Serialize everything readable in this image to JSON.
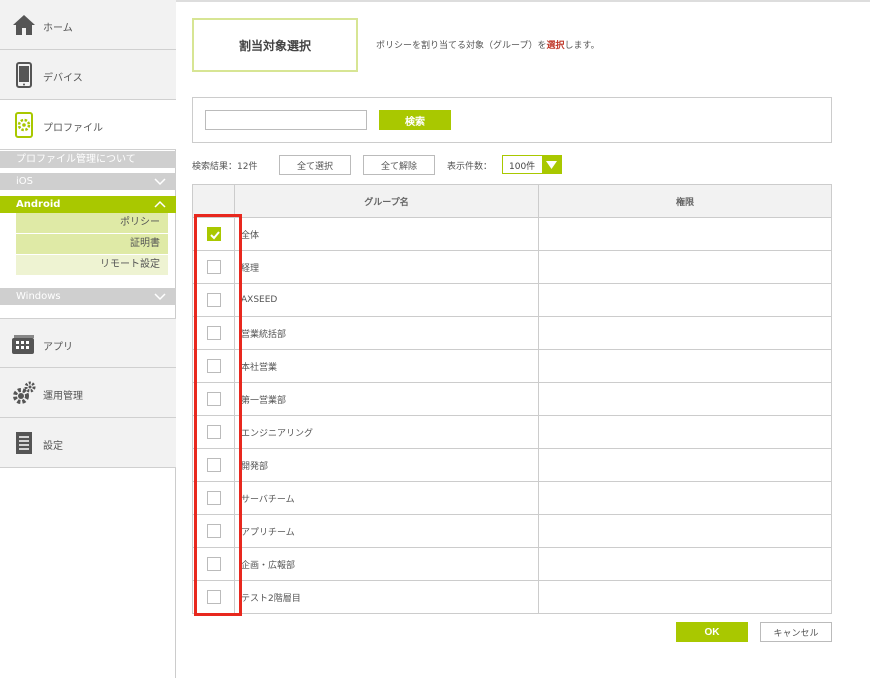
{
  "sidebar": {
    "nav": [
      {
        "label": "ホーム",
        "icon": "home-icon"
      },
      {
        "label": "デバイス",
        "icon": "device-icon"
      },
      {
        "label": "プロファイル",
        "icon": "profile-icon"
      },
      {
        "label": "アプリ",
        "icon": "app-icon"
      },
      {
        "label": "運用管理",
        "icon": "gear-icon"
      },
      {
        "label": "設定",
        "icon": "document-icon"
      }
    ],
    "profile_about": "プロファイル管理について",
    "ios": "iOS",
    "android": "Android",
    "android_items": [
      "ポリシー",
      "証明書",
      "リモート設定"
    ],
    "windows": "Windows"
  },
  "main": {
    "title": "割当対象選択",
    "desc_before": "ポリシーを割り当てる対象（グループ）を",
    "desc_em": "選択",
    "desc_after": "します。",
    "search_button": "検索",
    "search_value": "",
    "result_text": "検索結果：12件",
    "select_all": "全て選択",
    "unselect_all": "全て解除",
    "count_label": "表示件数：",
    "count_value": "100件",
    "col_group": "グループ名",
    "col_permission": "権限",
    "ok": "OK",
    "cancel": "キャンセル"
  },
  "rows": [
    {
      "name": "全体",
      "checked": true,
      "permission": ""
    },
    {
      "name": "経理",
      "checked": false,
      "permission": ""
    },
    {
      "name": "AXSEED",
      "checked": false,
      "permission": ""
    },
    {
      "name": "営業統括部",
      "checked": false,
      "permission": ""
    },
    {
      "name": "本社営業",
      "checked": false,
      "permission": ""
    },
    {
      "name": "第一営業部",
      "checked": false,
      "permission": ""
    },
    {
      "name": "エンジニアリング",
      "checked": false,
      "permission": ""
    },
    {
      "name": "開発部",
      "checked": false,
      "permission": ""
    },
    {
      "name": "サーバチーム",
      "checked": false,
      "permission": ""
    },
    {
      "name": "アプリチーム",
      "checked": false,
      "permission": ""
    },
    {
      "name": "企画・広報部",
      "checked": false,
      "permission": ""
    },
    {
      "name": "テスト2階層目",
      "checked": false,
      "permission": ""
    }
  ],
  "colors": {
    "accent": "#a9c800",
    "highlight": "#e8281e"
  }
}
